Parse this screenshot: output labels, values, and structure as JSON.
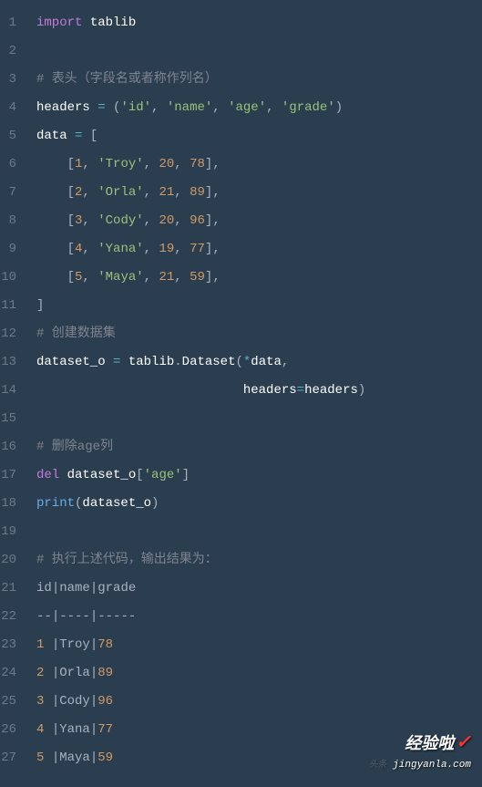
{
  "gutter": {
    "lines": [
      "1",
      "2",
      "3",
      "4",
      "5",
      "6",
      "7",
      "8",
      "9",
      "10",
      "11",
      "12",
      "13",
      "14",
      "15",
      "16",
      "17",
      "18",
      "19",
      "20",
      "21",
      "22",
      "23",
      "24",
      "25",
      "26",
      "27"
    ]
  },
  "code": {
    "l1_import": "import",
    "l1_module": "tablib",
    "l3_comment": "# 表头（字段名或者称作列名）",
    "l4_headers": "headers",
    "l4_eq": "=",
    "l4_lp": "(",
    "l4_s1": "'id'",
    "l4_c1": ",",
    "l4_s2": "'name'",
    "l4_c2": ",",
    "l4_s3": "'age'",
    "l4_c3": ",",
    "l4_s4": "'grade'",
    "l4_rp": ")",
    "l5_data": "data",
    "l5_eq": "=",
    "l5_lb": "[",
    "l6_lb": "[",
    "l6_n1": "1",
    "l6_c1": ",",
    "l6_s": "'Troy'",
    "l6_c2": ",",
    "l6_n2": "20",
    "l6_c3": ",",
    "l6_n3": "78",
    "l6_rb": "]",
    "l6_c4": ",",
    "l7_lb": "[",
    "l7_n1": "2",
    "l7_c1": ",",
    "l7_s": "'Orla'",
    "l7_c2": ",",
    "l7_n2": "21",
    "l7_c3": ",",
    "l7_n3": "89",
    "l7_rb": "]",
    "l7_c4": ",",
    "l8_lb": "[",
    "l8_n1": "3",
    "l8_c1": ",",
    "l8_s": "'Cody'",
    "l8_c2": ",",
    "l8_n2": "20",
    "l8_c3": ",",
    "l8_n3": "96",
    "l8_rb": "]",
    "l8_c4": ",",
    "l9_lb": "[",
    "l9_n1": "4",
    "l9_c1": ",",
    "l9_s": "'Yana'",
    "l9_c2": ",",
    "l9_n2": "19",
    "l9_c3": ",",
    "l9_n3": "77",
    "l9_rb": "]",
    "l9_c4": ",",
    "l10_lb": "[",
    "l10_n1": "5",
    "l10_c1": ",",
    "l10_s": "'Maya'",
    "l10_c2": ",",
    "l10_n2": "21",
    "l10_c3": ",",
    "l10_n3": "59",
    "l10_rb": "]",
    "l10_c4": ",",
    "l11_rb": "]",
    "l12_comment": "# 创建数据集",
    "l13_ds": "dataset_o",
    "l13_eq": "=",
    "l13_mod": "tablib",
    "l13_dot": ".",
    "l13_cls": "Dataset",
    "l13_lp": "(",
    "l13_star": "*",
    "l13_data": "data",
    "l13_c": ",",
    "l14_kw": "headers",
    "l14_eq": "=",
    "l14_val": "headers",
    "l14_rp": ")",
    "l16_comment": "# 删除age列",
    "l17_del": "del",
    "l17_ds": "dataset_o",
    "l17_lb": "[",
    "l17_s": "'age'",
    "l17_rb": "]",
    "l18_print": "print",
    "l18_lp": "(",
    "l18_ds": "dataset_o",
    "l18_rp": ")",
    "l20_comment": "# 执行上述代码，输出结果为：",
    "l21_id": "id",
    "l21_p1": "|",
    "l21_name": "name",
    "l21_p2": "|",
    "l21_grade": "grade",
    "l22_d1": "--",
    "l22_p1": "|",
    "l22_d2": "----",
    "l22_p2": "|",
    "l22_d3": "-----",
    "l23_n": "1",
    "l23_sp": " ",
    "l23_p1": "|",
    "l23_name": "Troy",
    "l23_p2": "|",
    "l23_g": "78",
    "l24_n": "2",
    "l24_sp": " ",
    "l24_p1": "|",
    "l24_name": "Orla",
    "l24_p2": "|",
    "l24_g": "89",
    "l25_n": "3",
    "l25_sp": " ",
    "l25_p1": "|",
    "l25_name": "Cody",
    "l25_p2": "|",
    "l25_g": "96",
    "l26_n": "4",
    "l26_sp": " ",
    "l26_p1": "|",
    "l26_name": "Yana",
    "l26_p2": "|",
    "l26_g": "77",
    "l27_n": "5",
    "l27_sp": " ",
    "l27_p1": "|",
    "l27_name": "Maya",
    "l27_p2": "|",
    "l27_g": "59"
  },
  "watermark": {
    "logo_text": "经验啦",
    "url": "jingyanla.com",
    "toutiao": "头条"
  }
}
